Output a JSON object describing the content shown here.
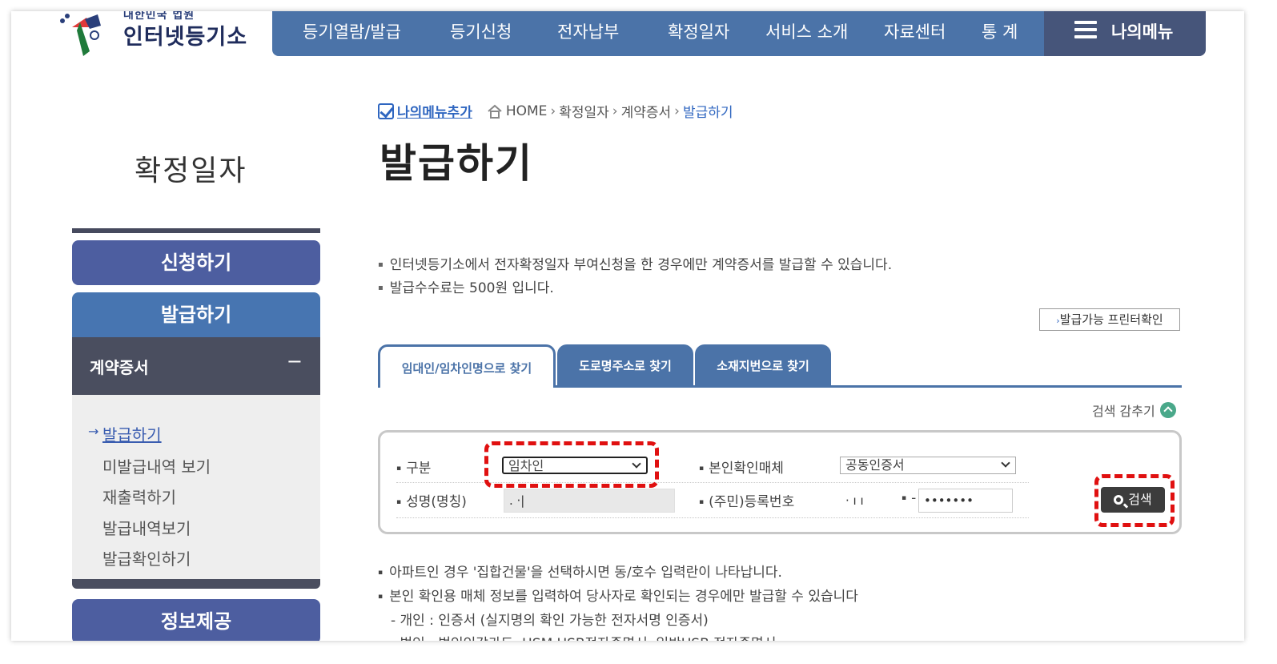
{
  "header": {
    "logo_sub": "대한민국 법원",
    "logo_main": "인터넷등기소",
    "nav": [
      "등기열람/발급",
      "등기신청",
      "전자납부",
      "확정일자",
      "서비스 소개",
      "자료센터",
      "통 계"
    ],
    "my_menu": "나의메뉴"
  },
  "sidebar": {
    "title": "확정일자",
    "apply": "신청하기",
    "issue": "발급하기",
    "section": "계약증서",
    "section_toggle": "−",
    "items": [
      "발급하기",
      "미발급내역 보기",
      "재출력하기",
      "발급내역보기",
      "발급확인하기"
    ],
    "info": "정보제공"
  },
  "breadcrumb": {
    "add": "나의메뉴추가",
    "home": "HOME",
    "path": [
      "확정일자",
      "계약증서"
    ],
    "current": "발급하기"
  },
  "page_title": "발급하기",
  "notices": [
    "인터넷등기소에서 전자확정일자 부여신청을 한 경우에만 계약증서를 발급할 수 있습니다.",
    "발급수수료는 500원 입니다."
  ],
  "printer_button": "발급가능 프린터확인",
  "tabs": [
    "임대인/임차인명으로 찾기",
    "도로명주소로 찾기",
    "소재지번으로 찾기"
  ],
  "hide_search": "검색 감추기",
  "form": {
    "type_label": "구분",
    "type_value": "임차인",
    "auth_label": "본인확인매체",
    "auth_value": "공동인증서",
    "name_label": "성명(명칭)",
    "name_value": ". ·|",
    "regno_label": "(주민)등록번호",
    "regno_front": "· ı ı",
    "regno_dash": "-",
    "regno_back": "•••••••",
    "search_button": "검색"
  },
  "footer_notes": [
    "아파트인 경우 '집합건물'을 선택하시면 동/호수 입력란이 나타납니다.",
    "본인 확인용 매체 정보를 입력하여 당사자로 확인되는 경우에만 발급할 수 있습니다",
    "- 개인 : 인증서 (실지명의 확인 가능한 전자서명 인증서)",
    "- 법인 : 법인인감카드, HSM USB전자증명서, 일반USB 전자증명서"
  ],
  "colors": {
    "nav_blue": "#4b73a8",
    "sidebar_button": "#4d5ea0",
    "dark_header": "#4a4e5f",
    "highlight_red": "#e01010"
  }
}
